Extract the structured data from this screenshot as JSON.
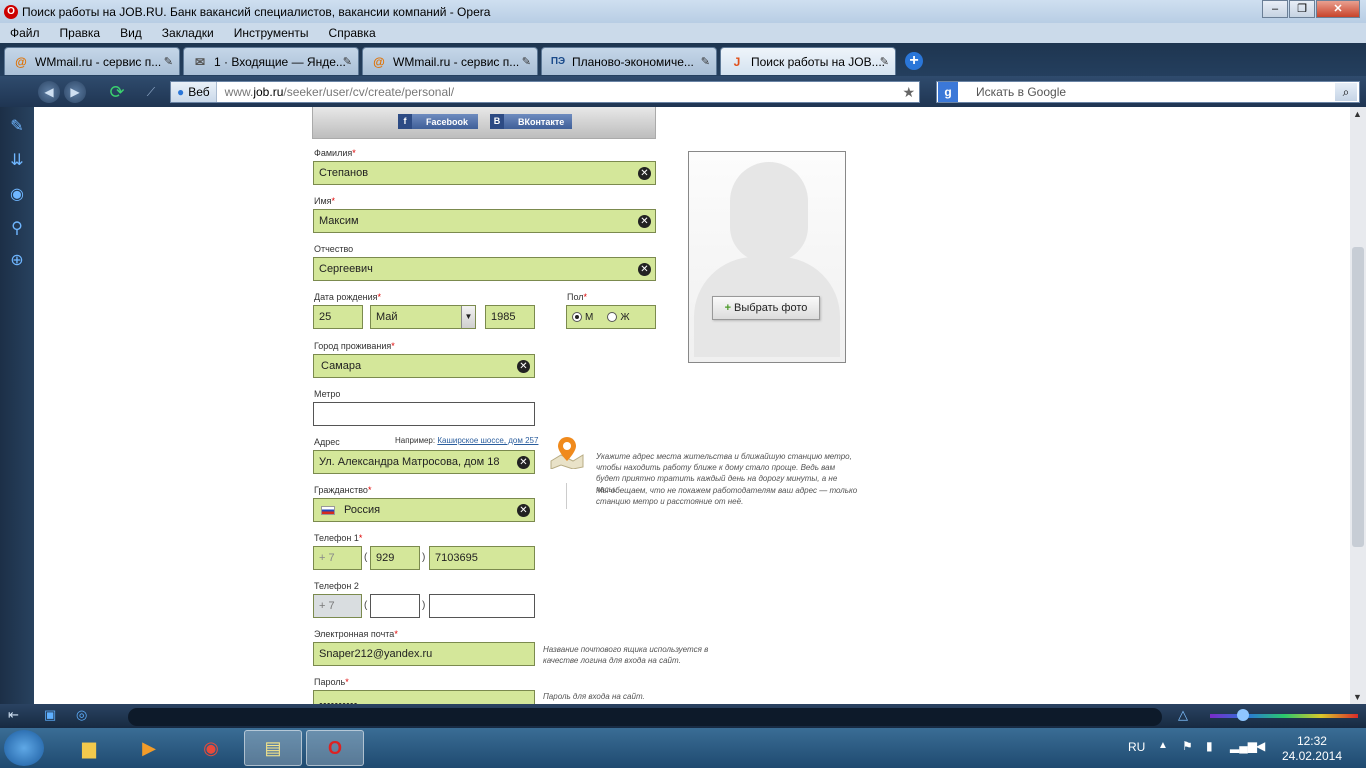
{
  "window": {
    "title": "Поиск работы на JOB.RU. Банк вакансий специалистов, вакансии компаний - Opera"
  },
  "menu": [
    "Файл",
    "Правка",
    "Вид",
    "Закладки",
    "Инструменты",
    "Справка"
  ],
  "tabs": [
    {
      "label": "WMmail.ru - сервис п...",
      "icon": "@"
    },
    {
      "label": "1 · Входящие — Янде...",
      "icon": "✉"
    },
    {
      "label": "WMmail.ru - сервис п...",
      "icon": "@"
    },
    {
      "label": "Планово-экономиче...",
      "icon": "ПЭ"
    },
    {
      "label": "Поиск работы на JOB....",
      "icon": "J"
    }
  ],
  "address": {
    "web_label": "Веб",
    "url_prefix": "www.",
    "url_domain": "job.ru",
    "url_path": "/seeker/user/cv/create/personal/"
  },
  "search": {
    "placeholder": "Искать в Google"
  },
  "social": {
    "facebook": "Facebook",
    "vkontakte": "ВКонтакте"
  },
  "form": {
    "surname": {
      "label": "Фамилия",
      "value": "Степанов"
    },
    "name": {
      "label": "Имя",
      "value": "Максим"
    },
    "patronymic": {
      "label": "Отчество",
      "value": "Сергеевич"
    },
    "birthdate": {
      "label": "Дата рождения",
      "day": "25",
      "month": "Май",
      "year": "1985"
    },
    "gender": {
      "label": "Пол",
      "male": "М",
      "female": "Ж",
      "selected": "М"
    },
    "city": {
      "label": "Город проживания",
      "value": "Самара"
    },
    "metro": {
      "label": "Метро",
      "value": ""
    },
    "address": {
      "label": "Адрес",
      "example_prefix": "Например:",
      "example_link": "Каширское шоссе, дом 257",
      "value": "Ул. Александра Матросова, дом 18"
    },
    "citizenship": {
      "label": "Гражданство",
      "value": "Россия"
    },
    "phone1": {
      "label": "Телефон 1",
      "country": "+ 7",
      "code": "929",
      "number": "7103695"
    },
    "phone2": {
      "label": "Телефон 2",
      "country": "+ 7",
      "code": "",
      "number": ""
    },
    "email": {
      "label": "Электронная почта",
      "value": "Snaper212@yandex.ru",
      "note": "Название почтового ящика используется в качестве логина для входа на сайт."
    },
    "password": {
      "label": "Пароль",
      "value": "••••••••••",
      "note": "Пароль для входа на сайт."
    }
  },
  "address_note": {
    "p1": "Укажите адрес места жительства и ближайшую станцию метро, чтобы находить работу ближе к дому стало проще. Ведь вам будет приятно тратить каждый день на дорогу минуты, а не часы.",
    "p2": "Мы обещаем, что не покажем работодателям ваш адрес — только станцию метро и расстояние от неё."
  },
  "photo": {
    "button": "Выбрать фото"
  },
  "taskbar": {
    "language": "RU",
    "time": "12:32",
    "date": "24.02.2014"
  }
}
